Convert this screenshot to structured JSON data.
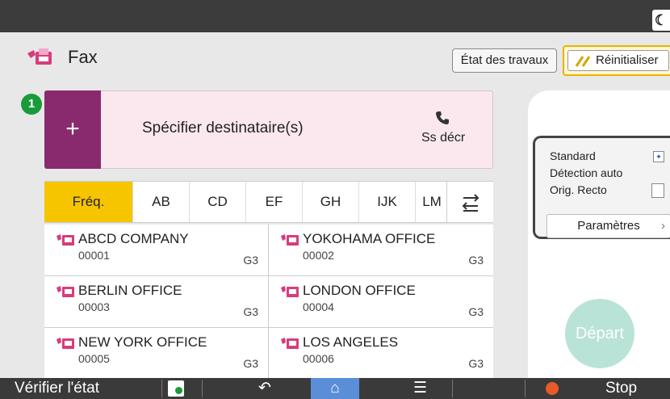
{
  "app": {
    "title": "Fax"
  },
  "header": {
    "jobs_label": "État des travaux",
    "reset_label": "Réinitialiser"
  },
  "destination": {
    "step_number": "1",
    "add_symbol": "+",
    "label": "Spécifier destinataire(s)",
    "manual_label": "Ss décr"
  },
  "tabs": [
    {
      "label": "Fréq.",
      "active": true
    },
    {
      "label": "AB"
    },
    {
      "label": "CD"
    },
    {
      "label": "EF"
    },
    {
      "label": "GH"
    },
    {
      "label": "IJK"
    },
    {
      "label": "LM"
    }
  ],
  "contacts": [
    {
      "name": "ABCD COMPANY",
      "number": "00001",
      "mode": "G3"
    },
    {
      "name": "YOKOHAMA OFFICE",
      "number": "00002",
      "mode": "G3"
    },
    {
      "name": "BERLIN OFFICE",
      "number": "00003",
      "mode": "G3"
    },
    {
      "name": "LONDON OFFICE",
      "number": "00004",
      "mode": "G3"
    },
    {
      "name": "NEW YORK OFFICE",
      "number": "00005",
      "mode": "G3"
    },
    {
      "name": "LOS ANGELES",
      "number": "00006",
      "mode": "G3"
    }
  ],
  "settings": {
    "resolution": "Standard",
    "detection": "Détection auto",
    "original": "Orig. Recto",
    "button_label": "Paramètres"
  },
  "start_label": "Départ",
  "bottom": {
    "check_status": "Vérifier l'état",
    "stop": "Stop"
  },
  "colors": {
    "accent_yellow": "#f7c400",
    "fax_purple": "#8a2a6e",
    "start_green": "#b9e3d7",
    "step_green": "#1a9b3a"
  }
}
